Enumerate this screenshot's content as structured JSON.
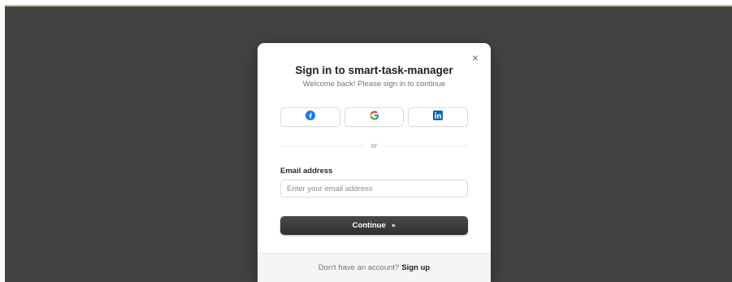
{
  "modal": {
    "close_label": "×",
    "title": "Sign in to smart-task-manager",
    "subtitle": "Welcome back! Please sign in to continue",
    "social_buttons": [
      {
        "name": "facebook",
        "icon": "facebook-icon",
        "color": "#1877F2"
      },
      {
        "name": "google",
        "icon": "google-icon",
        "color": "#4285F4"
      },
      {
        "name": "linkedin",
        "icon": "linkedin-icon",
        "color": "#0A66C2"
      }
    ],
    "divider_text": "or",
    "email": {
      "label": "Email address",
      "placeholder": "Enter your email address",
      "value": ""
    },
    "continue_label": "Continue",
    "continue_caret": "▶",
    "footer": {
      "prompt": "Don't have an account?",
      "link": "Sign up"
    }
  },
  "colors": {
    "backdrop": "#434343",
    "primary_button": "#333333",
    "accent_line": "#c9b98a"
  }
}
